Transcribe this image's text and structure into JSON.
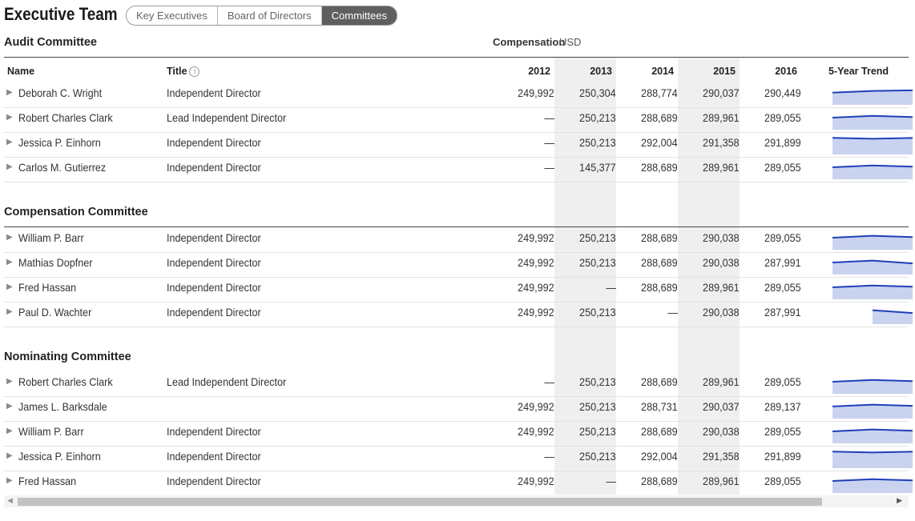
{
  "page": {
    "title": "Executive Team"
  },
  "tabs": [
    {
      "label": "Key Executives",
      "active": false
    },
    {
      "label": "Board of Directors",
      "active": false
    },
    {
      "label": "Committees",
      "active": true
    }
  ],
  "compensation": {
    "label": "Compensation",
    "unit": "USD"
  },
  "columns": {
    "name": "Name",
    "title": "Title",
    "years": [
      "2012",
      "2013",
      "2014",
      "2015",
      "2016"
    ],
    "trend": "5-Year Trend"
  },
  "sections": [
    {
      "title": "Audit Committee",
      "rows": [
        {
          "name": "Deborah C. Wright",
          "role": "Independent Director",
          "values": [
            "249,992",
            "250,304",
            "288,774",
            "290,037",
            "290,449"
          ]
        },
        {
          "name": "Robert Charles Clark",
          "role": "Lead Independent Director",
          "values": [
            "—",
            "250,213",
            "288,689",
            "289,961",
            "289,055"
          ]
        },
        {
          "name": "Jessica P. Einhorn",
          "role": "Independent Director",
          "values": [
            "—",
            "250,213",
            "292,004",
            "291,358",
            "291,899"
          ]
        },
        {
          "name": "Carlos M. Gutierrez",
          "role": "Independent Director",
          "values": [
            "—",
            "145,377",
            "288,689",
            "289,961",
            "289,055"
          ]
        }
      ]
    },
    {
      "title": "Compensation Committee",
      "rows": [
        {
          "name": "William P. Barr",
          "role": "Independent Director",
          "values": [
            "249,992",
            "250,213",
            "288,689",
            "290,038",
            "289,055"
          ]
        },
        {
          "name": "Mathias Dopfner",
          "role": "Independent Director",
          "values": [
            "249,992",
            "250,213",
            "288,689",
            "290,038",
            "287,991"
          ]
        },
        {
          "name": "Fred Hassan",
          "role": "Independent Director",
          "values": [
            "249,992",
            "—",
            "288,689",
            "289,961",
            "289,055"
          ]
        },
        {
          "name": "Paul D. Wachter",
          "role": "Independent Director",
          "values": [
            "249,992",
            "250,213",
            "—",
            "290,038",
            "287,991"
          ]
        }
      ]
    },
    {
      "title": "Nominating Committee",
      "rows": [
        {
          "name": "Robert Charles Clark",
          "role": "Lead Independent Director",
          "values": [
            "—",
            "250,213",
            "288,689",
            "289,961",
            "289,055"
          ]
        },
        {
          "name": "James L. Barksdale",
          "role": "",
          "values": [
            "249,992",
            "250,213",
            "288,731",
            "290,037",
            "289,137"
          ]
        },
        {
          "name": "William P. Barr",
          "role": "Independent Director",
          "values": [
            "249,992",
            "250,213",
            "288,689",
            "290,038",
            "289,055"
          ]
        },
        {
          "name": "Jessica P. Einhorn",
          "role": "Independent Director",
          "values": [
            "—",
            "250,213",
            "292,004",
            "291,358",
            "291,899"
          ]
        },
        {
          "name": "Fred Hassan",
          "role": "Independent Director",
          "values": [
            "249,992",
            "—",
            "288,689",
            "289,961",
            "289,055"
          ]
        }
      ]
    }
  ],
  "colors": {
    "trend_line": "#1f3fb8",
    "trend_fill": "#c9d3f0",
    "shaded_column": "#efefef",
    "active_tab": "#5f5f5f"
  }
}
